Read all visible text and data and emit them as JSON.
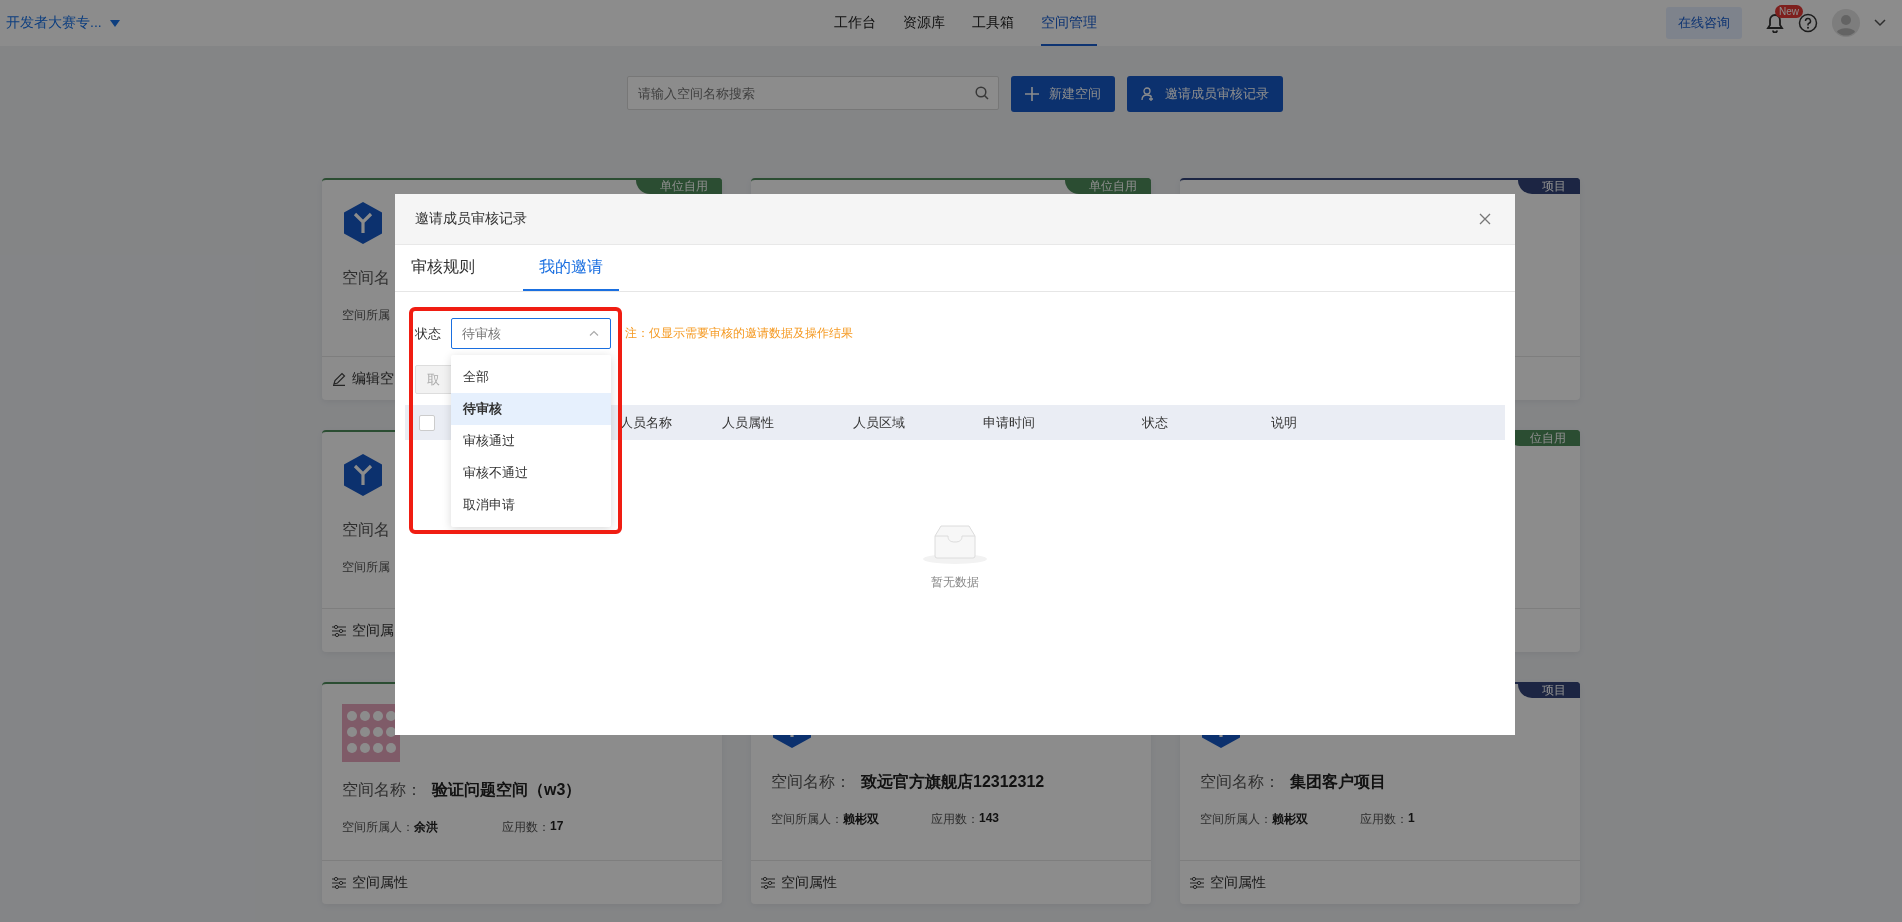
{
  "brand": {
    "label": "开发者大赛专..."
  },
  "nav": [
    {
      "label": "工作台",
      "selected": false
    },
    {
      "label": "资源库",
      "selected": false
    },
    {
      "label": "工具箱",
      "selected": false
    },
    {
      "label": "空间管理",
      "selected": true
    }
  ],
  "header_actions": {
    "consult_button": "在线咨询",
    "notification_badge": "New"
  },
  "search": {
    "placeholder": "请输入空间名称搜索"
  },
  "actions": [
    {
      "kind": "add",
      "label": "新建空间"
    },
    {
      "kind": "invite",
      "label": "邀请成员审核记录"
    }
  ],
  "cards": [
    {
      "kind": "unit",
      "tag": "单位自用",
      "logo": {
        "kind": "emblem"
      },
      "name_label": "空间名",
      "owner_label": "空间所属",
      "footer": {
        "kind": "edit",
        "label": "编辑空"
      }
    },
    {
      "kind": "unit",
      "tag": "单位自用"
    },
    {
      "kind": "project",
      "tag": "项目"
    },
    {
      "kind": "unit",
      "logo": {
        "kind": "emblem"
      },
      "name_label": "空间名",
      "owner_label": "空间所属",
      "footer": {
        "kind": "properties",
        "label": "空间属"
      }
    },
    {
      "kind": "unit",
      "tag": "位自用"
    },
    {
      "kind": "unit",
      "name_label": "空间名称：",
      "name": "验证问题空间（w3）",
      "owner_label": "空间所属人：",
      "owner": "余洪",
      "apps_label": "应用数：",
      "apps": "17",
      "footer": {
        "kind": "properties",
        "label": "空间属性"
      }
    },
    {
      "logo": {
        "kind": "emblem"
      },
      "name_label": "空间名称：",
      "name": "致远官方旗舰店12312312",
      "owner_label": "空间所属人：",
      "owner": "赖彬双",
      "apps_label": "应用数：",
      "apps": "143",
      "footer": {
        "kind": "properties",
        "label": "空间属性"
      }
    },
    {
      "kind": "project",
      "tag": "项目",
      "logo": {
        "kind": "emblem"
      },
      "name_label": "空间名称：",
      "name": "集团客户项目",
      "owner_label": "空间所属人：",
      "owner": "赖彬双",
      "apps_label": "应用数：",
      "apps": "1",
      "footer": {
        "kind": "properties",
        "label": "空间属性"
      }
    }
  ],
  "modal": {
    "title": "邀请成员审核记录",
    "tabs": [
      {
        "label": "审核规则",
        "selected": false
      },
      {
        "label": "我的邀请",
        "selected": true
      }
    ],
    "filter": {
      "label": "状态",
      "placeholder": "待审核",
      "expanded": true,
      "options": [
        {
          "label": "全部",
          "selected": false
        },
        {
          "label": "待审核",
          "selected": true
        },
        {
          "label": "审核通过",
          "selected": false
        },
        {
          "label": "审核不通过",
          "selected": false
        },
        {
          "label": "取消申请",
          "selected": false
        }
      ],
      "note": "注：仅显示需要审核的邀请数据及操作结果"
    },
    "batch_button": {
      "label": "取",
      "disabled": true
    },
    "table": {
      "select_all_checked": false,
      "columns": [
        "人员名称",
        "人员属性",
        "人员区域",
        "申请时间",
        "状态",
        "说明"
      ],
      "empty_text": "暂无数据"
    }
  },
  "highlight_frame": true
}
